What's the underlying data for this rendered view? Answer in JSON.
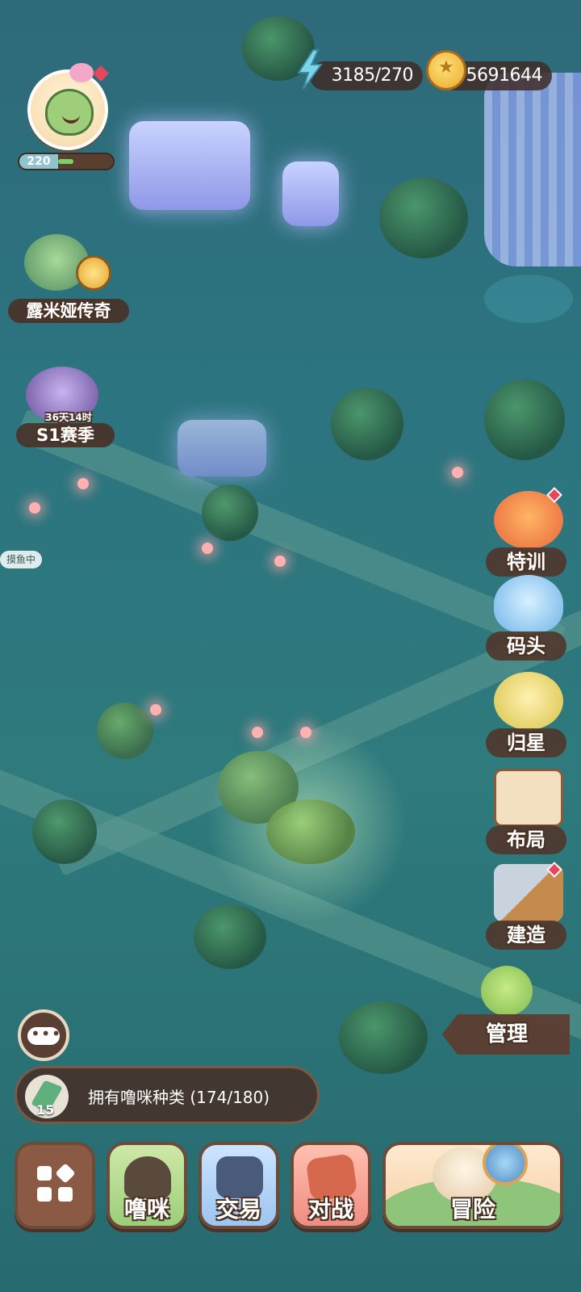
{
  "player": {
    "level": "220",
    "level_progress": 0.3
  },
  "resources": {
    "energy": "3185/270",
    "coins": "5691644"
  },
  "events": [
    {
      "label": "露米娅传奇"
    },
    {
      "label": "S1赛季",
      "timer": "36天14时"
    }
  ],
  "map_labels": {
    "fishing": "摸鱼中"
  },
  "side_menu": [
    {
      "label": "特训",
      "icon": "training-icon",
      "badge": true
    },
    {
      "label": "码头",
      "icon": "whale-icon",
      "badge": false
    },
    {
      "label": "归星",
      "icon": "star-tree-icon",
      "badge": false
    },
    {
      "label": "布局",
      "icon": "layout-scroll-icon",
      "badge": false
    },
    {
      "label": "建造",
      "icon": "hammer-icon",
      "badge": true
    },
    {
      "label": "管理",
      "icon": "robot-icon",
      "badge": false
    }
  ],
  "collection": {
    "count": "15",
    "text": "拥有噜咪种类 (174/180)"
  },
  "bottom_nav": {
    "pets": "噜咪",
    "trade": "交易",
    "battle": "对战",
    "adventure": "冒险"
  },
  "colors": {
    "panel": "#4a3328",
    "accent_green": "#7ed06a",
    "alert": "#e8465a"
  }
}
